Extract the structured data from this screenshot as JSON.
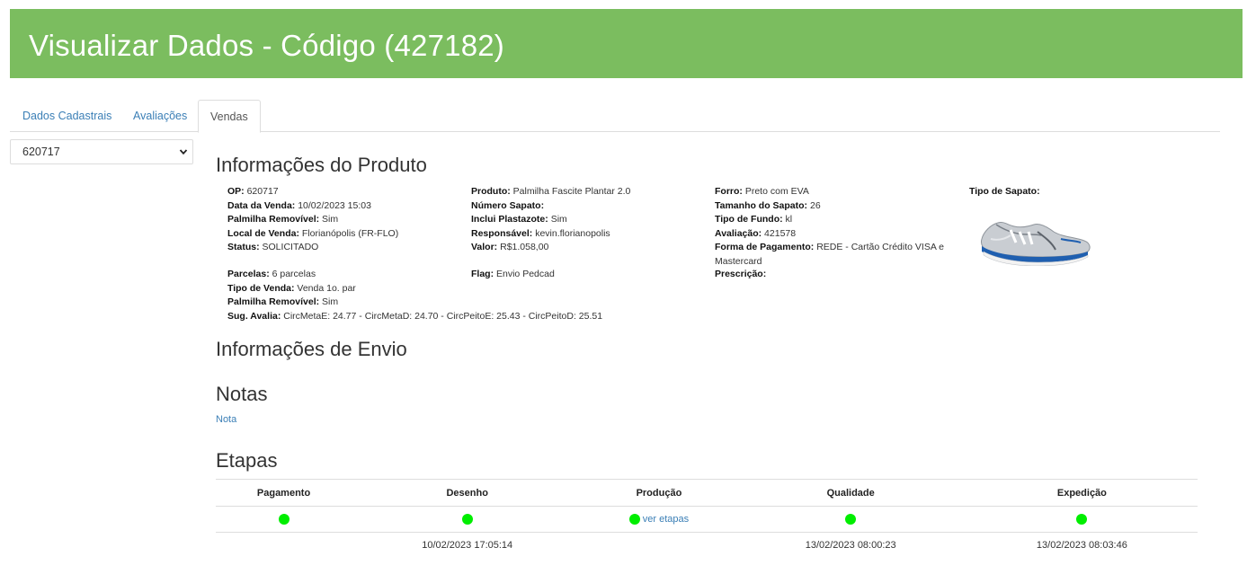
{
  "header": {
    "title": "Visualizar Dados - Código (427182)"
  },
  "tabs": [
    {
      "label": "Dados Cadastrais"
    },
    {
      "label": "Avaliações"
    },
    {
      "label": "Vendas"
    }
  ],
  "order_select": {
    "value": "620717"
  },
  "product": {
    "title": "Informações do Produto",
    "col1": [
      {
        "label": "OP:",
        "value": " 620717"
      },
      {
        "label": "Data da Venda:",
        "value": " 10/02/2023 15:03"
      },
      {
        "label": "Palmilha Removível:",
        "value": " Sim"
      },
      {
        "label": "Local de Venda:",
        "value": " Florianópolis (FR-FLO)"
      },
      {
        "label": "Status:",
        "value": " SOLICITADO"
      }
    ],
    "col1b": [
      {
        "label": "Parcelas:",
        "value": " 6 parcelas"
      },
      {
        "label": "Tipo de Venda:",
        "value": " Venda 1o. par"
      },
      {
        "label": "Palmilha Removível:",
        "value": " Sim"
      },
      {
        "label": "Sug. Avalia:",
        "value": " CircMetaE: 24.77 - CircMetaD: 24.70 - CircPeitoE: 25.43 - CircPeitoD: 25.51"
      }
    ],
    "col2": [
      {
        "label": "Produto:",
        "value": " Palmilha Fascite Plantar 2.0"
      },
      {
        "label": "Número Sapato:",
        "value": ""
      },
      {
        "label": "Inclui Plastazote:",
        "value": " Sim"
      },
      {
        "label": "Responsável:",
        "value": " kevin.florianopolis"
      },
      {
        "label": "Valor:",
        "value": " R$1.058,00"
      }
    ],
    "col2b": [
      {
        "label": "Flag:",
        "value": " Envio Pedcad"
      }
    ],
    "col3": [
      {
        "label": "Forro:",
        "value": " Preto com EVA"
      },
      {
        "label": "Tamanho do Sapato:",
        "value": " 26"
      },
      {
        "label": "Tipo de Fundo:",
        "value": " kl"
      },
      {
        "label": "Avaliação:",
        "value": " 421578"
      },
      {
        "label": "Forma de Pagamento:",
        "value": " REDE - Cartão Crédito VISA e Mastercard"
      }
    ],
    "col3b": [
      {
        "label": "Prescrição:",
        "value": ""
      }
    ],
    "shoe_type_label": "Tipo de Sapato:"
  },
  "shipping": {
    "title": "Informações de Envio"
  },
  "notes": {
    "title": "Notas",
    "link": "Nota"
  },
  "etapas": {
    "title": "Etapas",
    "headers": [
      "Pagamento",
      "Desenho",
      "Produção",
      "Qualidade",
      "Expedição"
    ],
    "status_link": "ver etapas",
    "dates": [
      "",
      "10/02/2023 17:05:14",
      "",
      "13/02/2023 08:00:23",
      "13/02/2023 08:03:46"
    ],
    "dot_color": "#00ee00"
  },
  "colors": {
    "header_bg": "#7bbd5f",
    "link": "#3b7fb6"
  }
}
